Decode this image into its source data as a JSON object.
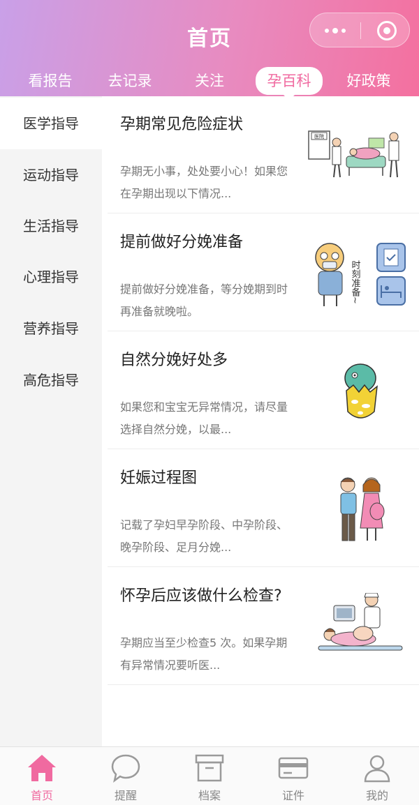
{
  "header": {
    "title": "首页",
    "tabs": [
      {
        "label": "看报告"
      },
      {
        "label": "去记录"
      },
      {
        "label": "关注"
      },
      {
        "label": "孕百科"
      },
      {
        "label": "好政策"
      }
    ],
    "active_tab": "孕百科",
    "capsule": {
      "more_icon": "more-dots-icon",
      "close_icon": "target-close-icon"
    }
  },
  "sidebar": {
    "items": [
      {
        "label": "医学指导"
      },
      {
        "label": "运动指导"
      },
      {
        "label": "生活指导"
      },
      {
        "label": "心理指导"
      },
      {
        "label": "营养指导"
      },
      {
        "label": "高危指导"
      }
    ],
    "active_item": "医学指导"
  },
  "articles": [
    {
      "title": "孕期常见危险症状",
      "desc": "孕期无小事，处处要小心！如果您在孕期出现以下情况...",
      "image": "hospital-illustration",
      "sign_text": "医院"
    },
    {
      "title": "提前做好分娩准备",
      "desc": "提前做好分娩准备，等分娩期到时再准备就晚啦。",
      "image": "prepare-illustration",
      "handwriting": "时刻准备~"
    },
    {
      "title": "自然分娩好处多",
      "desc": "如果您和宝宝无异常情况，请尽量选择自然分娩，以最...",
      "image": "hatching-egg-illustration"
    },
    {
      "title": "妊娠过程图",
      "desc": "记载了孕妇早孕阶段、中孕阶段、晚孕阶段、足月分娩...",
      "image": "couple-illustration"
    },
    {
      "title": "怀孕后应该做什么检查?",
      "desc": "孕期应当至少检查5 次。如果孕期有异常情况要听医...",
      "image": "nurse-checkup-illustration"
    }
  ],
  "tabbar": {
    "items": [
      {
        "label": "首页",
        "icon": "home-icon"
      },
      {
        "label": "提醒",
        "icon": "chat-bubble-icon"
      },
      {
        "label": "档案",
        "icon": "archive-box-icon"
      },
      {
        "label": "证件",
        "icon": "card-icon"
      },
      {
        "label": "我的",
        "icon": "user-icon"
      }
    ],
    "active_item": "首页"
  },
  "colors": {
    "accent": "#f06aa0",
    "header_gradient_start": "#c9a0e8",
    "header_gradient_end": "#f4709f",
    "sidebar_bg": "#f4f4f4"
  }
}
